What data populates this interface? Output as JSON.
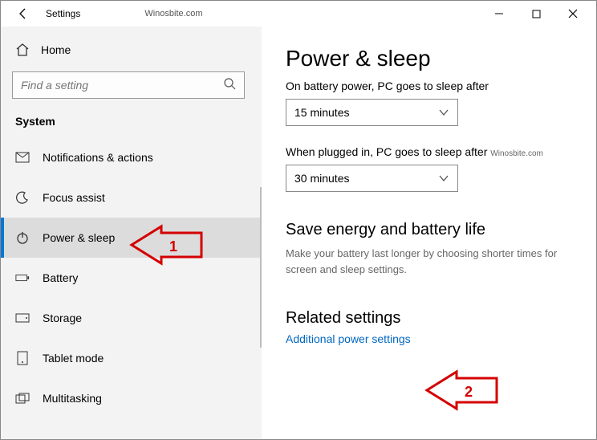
{
  "window": {
    "title": "Settings",
    "watermark_title": "Winosbite.com"
  },
  "sidebar": {
    "home_label": "Home",
    "search_placeholder": "Find a setting",
    "section_label": "System",
    "items": [
      {
        "label": "Notifications & actions"
      },
      {
        "label": "Focus assist"
      },
      {
        "label": "Power & sleep"
      },
      {
        "label": "Battery"
      },
      {
        "label": "Storage"
      },
      {
        "label": "Tablet mode"
      },
      {
        "label": "Multitasking"
      }
    ]
  },
  "main": {
    "heading": "Power & sleep",
    "battery_label": "On battery power, PC goes to sleep after",
    "battery_value": "15 minutes",
    "plugged_label": "When plugged in, PC goes to sleep after",
    "plugged_watermark": "Winosbite.com",
    "plugged_value": "30 minutes",
    "save_heading": "Save energy and battery life",
    "save_desc": "Make your battery last longer by choosing shorter times for screen and sleep settings.",
    "related_heading": "Related settings",
    "related_link": "Additional power settings"
  },
  "annotations": {
    "callout1": "1",
    "callout2": "2"
  }
}
